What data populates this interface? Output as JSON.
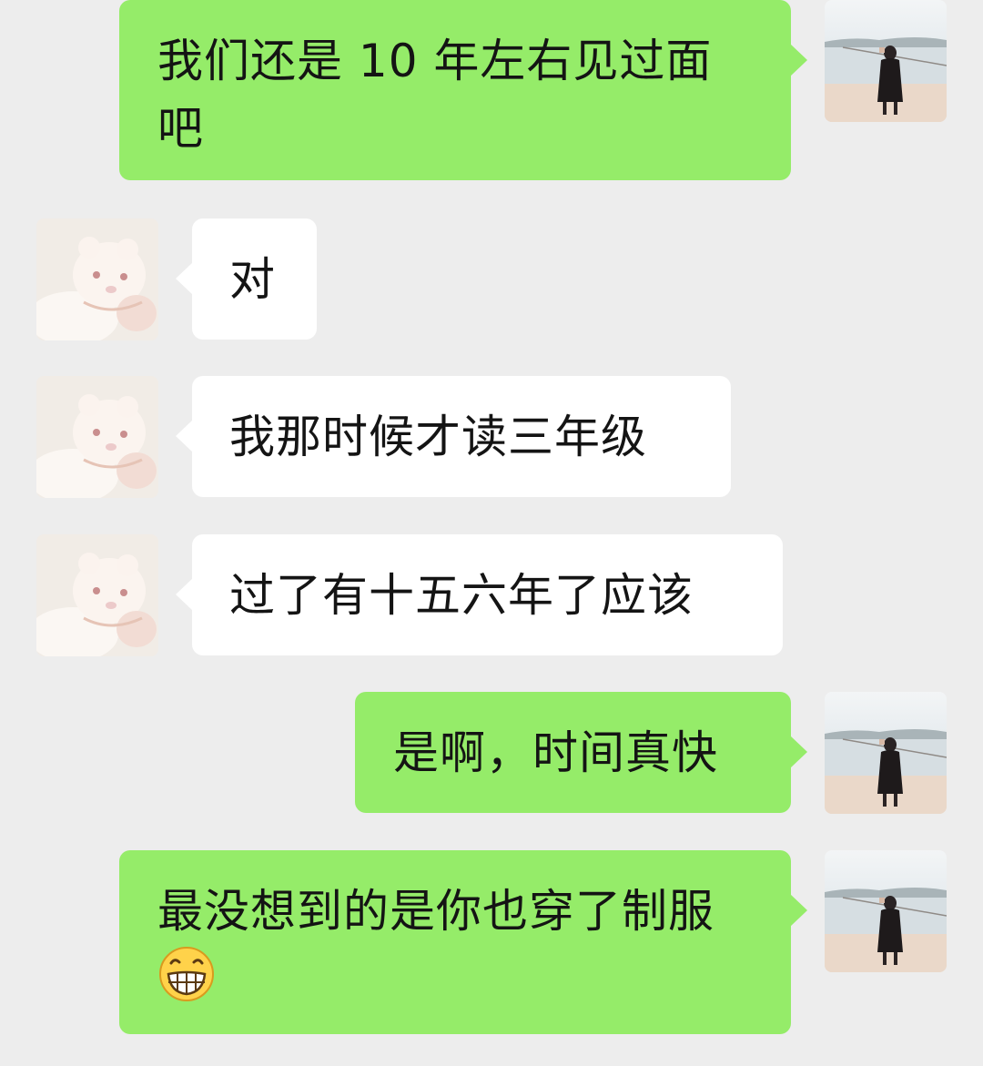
{
  "messages": [
    {
      "sender": "self",
      "text": "我们还是 10 年左右见过面吧"
    },
    {
      "sender": "other",
      "text": "对"
    },
    {
      "sender": "other",
      "text": "我那时候才读三年级"
    },
    {
      "sender": "other",
      "text": "过了有十五六年了应该"
    },
    {
      "sender": "self",
      "text": "是啊，时间真快"
    },
    {
      "sender": "self",
      "text": "最没想到的是你也穿了制服",
      "emoji": "grinning-face-icon"
    }
  ],
  "colors": {
    "background": "#ededed",
    "self_bubble": "#95ec69",
    "other_bubble": "#ffffff",
    "text": "#141414"
  }
}
